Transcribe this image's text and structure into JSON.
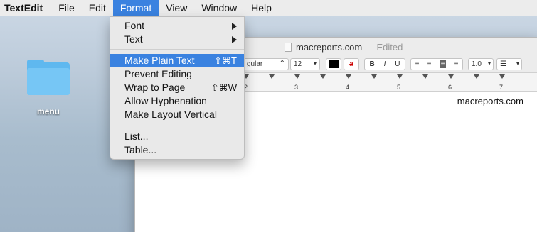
{
  "menubar": {
    "app": "TextEdit",
    "items": [
      "File",
      "Edit",
      "Format",
      "View",
      "Window",
      "Help"
    ]
  },
  "desktop": {
    "folder_label": "menu"
  },
  "window": {
    "title": "macreports.com",
    "edited": "— Edited",
    "toolbar": {
      "font_style": "gular",
      "font_size": "12",
      "bold": "B",
      "italic": "I",
      "underline": "U",
      "strike_char": "a",
      "line_spacing": "1.0"
    },
    "ruler_numbers": [
      "2",
      "3",
      "4",
      "5",
      "6",
      "7"
    ],
    "content_text": "macreports.com"
  },
  "format_menu": {
    "items": [
      {
        "label": "Font",
        "submenu": true
      },
      {
        "label": "Text",
        "submenu": true
      },
      {
        "label": "Make Plain Text",
        "shortcut": "⇧⌘T",
        "highlighted": true
      },
      {
        "label": "Prevent Editing"
      },
      {
        "label": "Wrap to Page",
        "shortcut": "⇧⌘W"
      },
      {
        "label": "Allow Hyphenation"
      },
      {
        "label": "Make Layout Vertical"
      },
      {
        "label": "List..."
      },
      {
        "label": "Table..."
      }
    ]
  },
  "colors": {
    "highlight": "#3a82e0",
    "menu_bg": "#e9e9e9",
    "folder": "#5fb8ef"
  }
}
